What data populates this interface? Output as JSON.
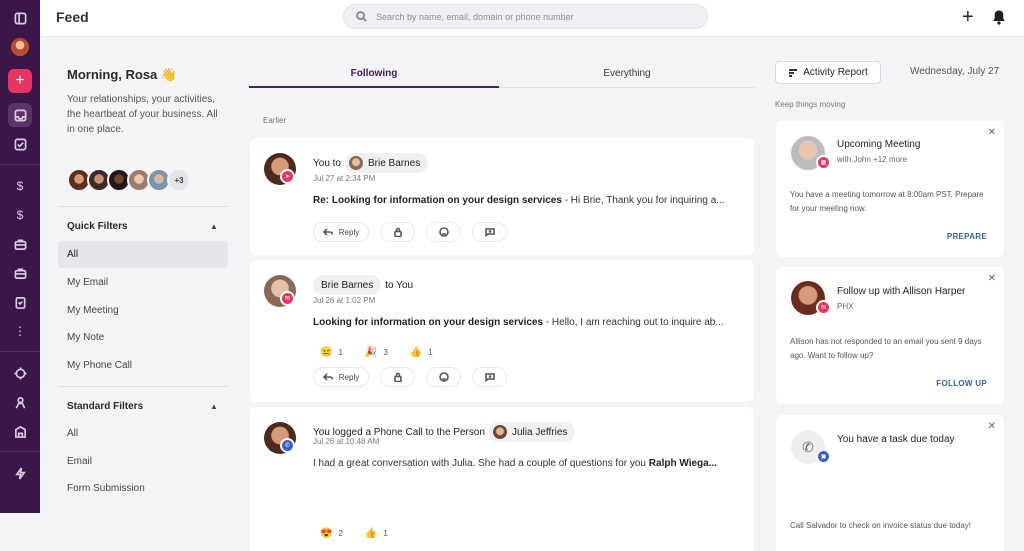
{
  "header": {
    "title": "Feed",
    "search_placeholder": "Search by name, email, domain or phone number"
  },
  "left": {
    "greeting": "Morning, Rosa 👋",
    "subtitle": "Your relationships, your activities, the heartbeat of your business. All in one place.",
    "more_count": "+3",
    "quick_filters": {
      "title": "Quick Filters",
      "items": [
        "All",
        "My Email",
        "My Meeting",
        "My Note",
        "My Phone Call"
      ]
    },
    "standard_filters": {
      "title": "Standard Filters",
      "items": [
        "All",
        "Email",
        "Form Submission"
      ]
    }
  },
  "tabs": {
    "following": "Following",
    "everything": "Everything"
  },
  "feed": {
    "section": "Earlier",
    "actions": {
      "reply": "Reply"
    },
    "items": [
      {
        "prefix": "You to",
        "person": "Brie Barnes",
        "suffix": "",
        "time": "Jul 27 at 2:34 PM",
        "subject": "Re: Looking for information on your design services",
        "preview": " -  Hi Brie,  Thank you for inquiring a..."
      },
      {
        "prefix": "",
        "person": "Brie Barnes",
        "suffix": "to You",
        "time": "Jul 26 at 1:02 PM",
        "subject": "Looking for information on your design services",
        "preview": " -  Hello, I am reaching out to inquire ab...",
        "reactions": [
          {
            "emoji": "😐",
            "count": "1"
          },
          {
            "emoji": "🎉",
            "count": "3"
          },
          {
            "emoji": "👍",
            "count": "1"
          }
        ]
      },
      {
        "prefix": "You logged a Phone Call to the Person",
        "person": "Julia Jeffries",
        "suffix": "",
        "time": "Jul 26 at 10:48 AM",
        "body": "I had a great conversation with Julia. She had a couple of questions for you ",
        "body_bold": "Ralph Wiega...",
        "reactions": [
          {
            "emoji": "😍",
            "count": "2"
          },
          {
            "emoji": "👍",
            "count": "1"
          }
        ]
      }
    ]
  },
  "right": {
    "report_button": "Activity Report",
    "date": "Wednesday, July 27",
    "keep": "Keep things moving",
    "cards": [
      {
        "title": "Upcoming Meeting",
        "sub": "with John +12 more",
        "text": "You have a meeting tomorrow at 8:00am PST. Prepare for your meeting now.",
        "action": "PREPARE"
      },
      {
        "title": "Follow up with Allison Harper",
        "sub": "PHX",
        "text": "Allison has not responded to an email you sent 9 days ago. Want to follow up?",
        "action": "FOLLOW UP"
      },
      {
        "title": "You have a task due today",
        "sub": "",
        "text": "Call Salvador to check on invoice status due today!",
        "action": ""
      }
    ]
  },
  "colors": {
    "rail": "#3a1748",
    "accent": "#e5365e",
    "tab_active": "#4b2260",
    "link": "#3a5fa8"
  }
}
